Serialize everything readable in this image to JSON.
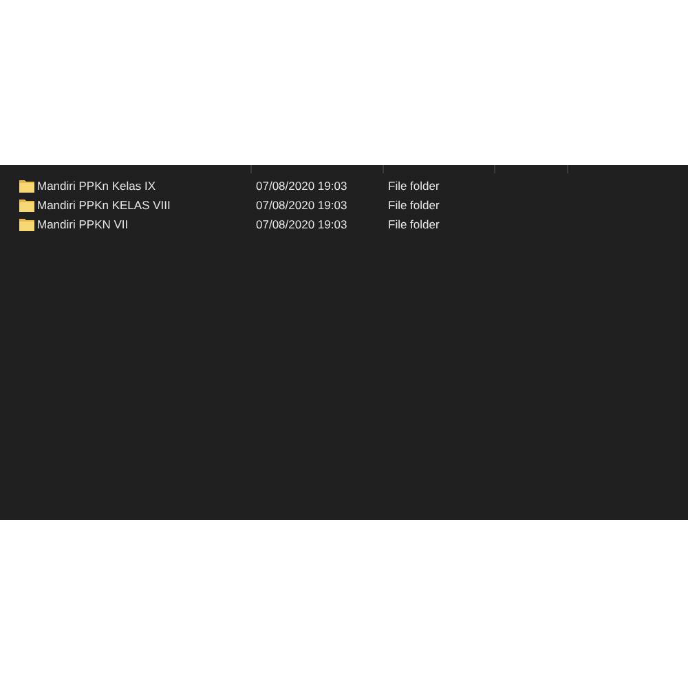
{
  "rows": [
    {
      "name": "Mandiri PPKn Kelas IX",
      "date_modified": "07/08/2020 19:03",
      "type": "File folder"
    },
    {
      "name": "Mandiri PPKn KELAS VIII",
      "date_modified": "07/08/2020 19:03",
      "type": "File folder"
    },
    {
      "name": "Mandiri PPKN VII",
      "date_modified": "07/08/2020 19:03",
      "type": "File folder"
    }
  ]
}
